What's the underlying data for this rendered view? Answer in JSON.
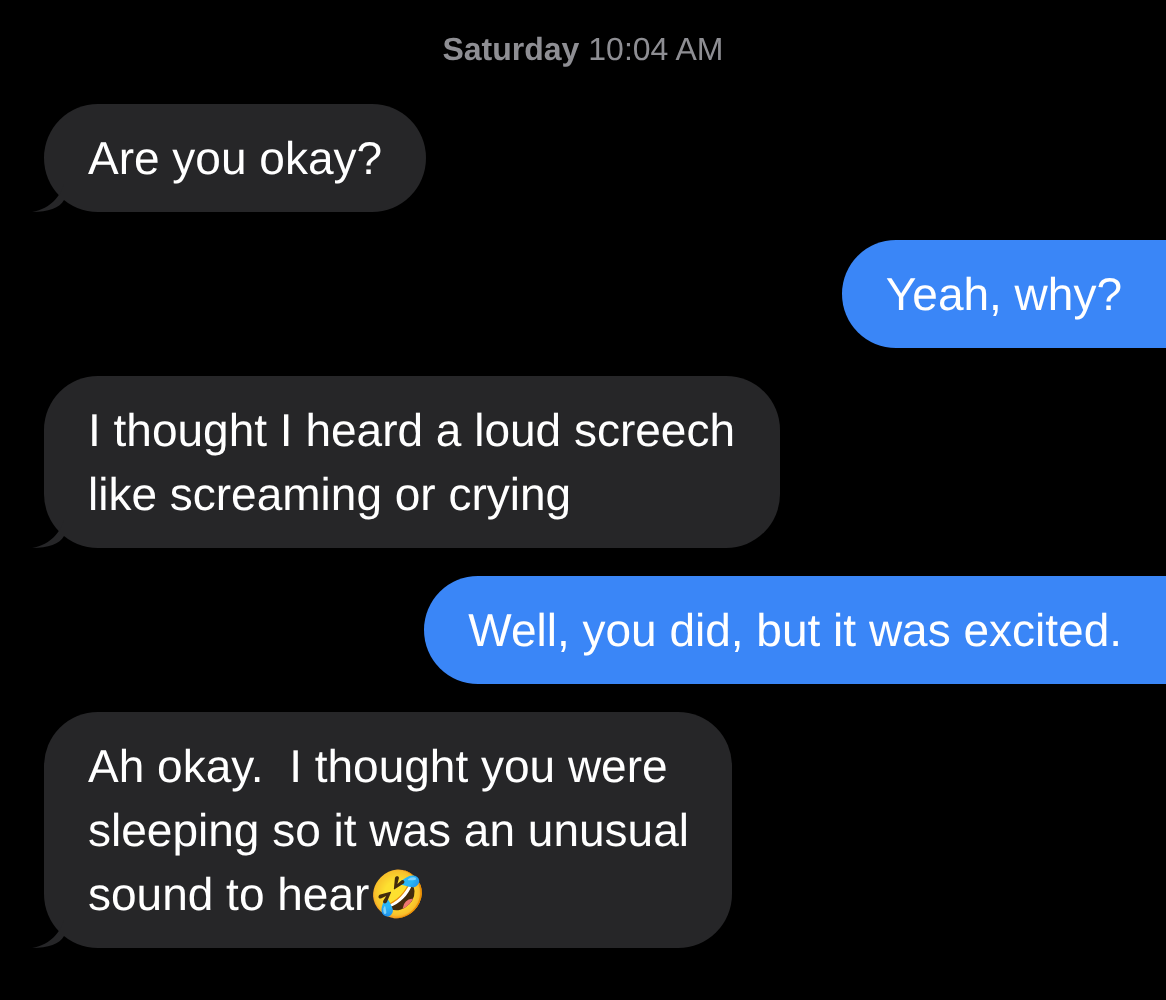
{
  "timestamp": "**Saturday** 10:04 AM",
  "messages": [
    {
      "kind": "received",
      "text": "Are you okay?"
    },
    {
      "kind": "sent",
      "text": "Yeah, why?"
    },
    {
      "kind": "received",
      "text": "I thought I heard a loud screech\nlike screaming or crying"
    },
    {
      "kind": "sent",
      "text": "Well, you did, but it was excited."
    },
    {
      "kind": "received",
      "text": "Ah okay.  I thought you were\nsleeping so it was an unusual\nsound to hear🤣"
    }
  ]
}
